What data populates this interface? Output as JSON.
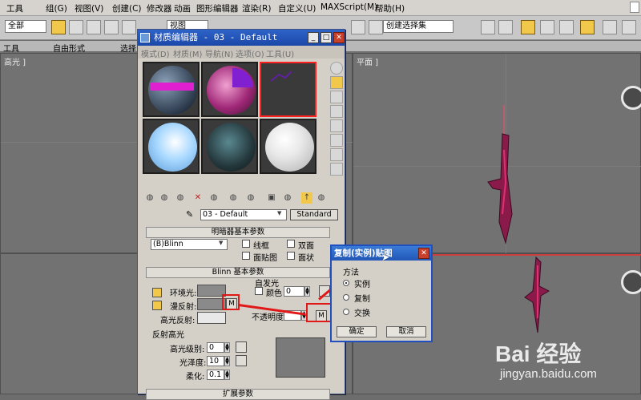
{
  "menubar": {
    "items": [
      "工具",
      "组(G)",
      "视图(V)",
      "创建(C)",
      "修改器",
      "动画",
      "图形编辑器",
      "渲染(R)",
      "自定义(U)",
      "MAXScript(M)",
      "帮助(H)"
    ]
  },
  "toolbar": {
    "filter_value": "全部",
    "refcoord_value": "视图",
    "selset_value": "创建选择集"
  },
  "ribbon": {
    "tabs": [
      "工具",
      "自由形式",
      "选择"
    ]
  },
  "viewports": {
    "left_label": "高光 ]",
    "right_label": "平面 ]"
  },
  "material_editor": {
    "title": "材质编辑器 - 03 - Default",
    "menu": [
      "模式(D)",
      "材质(M)",
      "导航(N)",
      "选项(O)",
      "工具(U)"
    ],
    "material_name": "03 - Default",
    "type_button": "Standard",
    "shader_rollout": "明暗器基本参数",
    "shader_value": "(B)Blinn",
    "shader_opts": [
      "线框",
      "双面",
      "面贴图",
      "面状"
    ],
    "blinn_rollout": "Blinn 基本参数",
    "self_illum_group": "自发光",
    "color_label": "颜色",
    "color_value": "0",
    "ambient_label": "环境光:",
    "diffuse_label": "漫反射:",
    "specular_label": "高光反射:",
    "opacity_label": "不透明度:",
    "m_button": "M",
    "highlight_group": "反射高光",
    "spec_level_label": "高光级别:",
    "spec_level_value": "0",
    "gloss_label": "光泽度:",
    "gloss_value": "10",
    "soften_label": "柔化:",
    "soften_value": "0.1",
    "extended_rollout": "扩展参数"
  },
  "copy_dialog": {
    "title": "复制(实例)贴图",
    "group_label": "方法",
    "options": [
      "实例",
      "复制",
      "交换"
    ],
    "selected": "实例",
    "ok": "确定",
    "cancel": "取消"
  },
  "watermark": {
    "brand": "Bai 经验",
    "url": "jingyan.baidu.com"
  },
  "colors": {
    "accent_red": "#e01818",
    "title_blue": "#2050c0"
  }
}
